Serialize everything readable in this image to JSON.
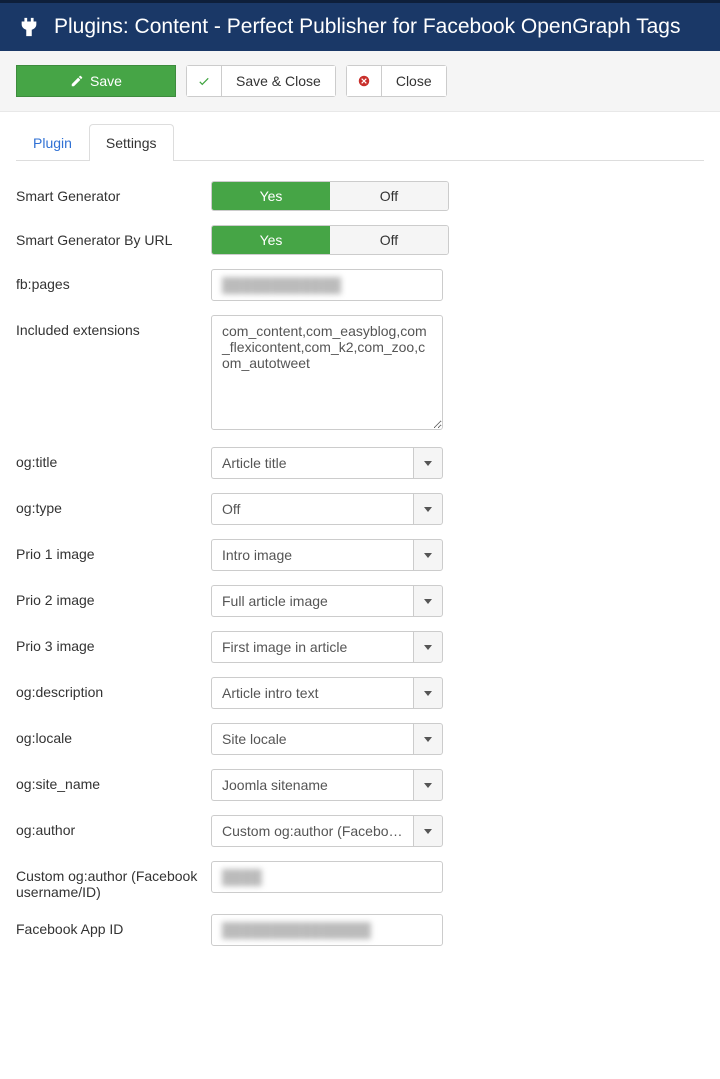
{
  "header": {
    "title": "Plugins: Content - Perfect Publisher for Facebook OpenGraph Tags"
  },
  "toolbar": {
    "save": "Save",
    "save_close": "Save & Close",
    "close": "Close"
  },
  "tabs": {
    "plugin": "Plugin",
    "settings": "Settings",
    "active": "settings"
  },
  "fields": {
    "smart_generator": {
      "label": "Smart Generator",
      "yes": "Yes",
      "no": "Off",
      "value": "Yes"
    },
    "smart_generator_url": {
      "label": "Smart Generator By URL",
      "yes": "Yes",
      "no": "Off",
      "value": "Yes"
    },
    "fb_pages": {
      "label": "fb:pages",
      "value": "████████████"
    },
    "included_ext": {
      "label": "Included extensions",
      "value": "com_content,com_easyblog,com_flexicontent,com_k2,com_zoo,com_autotweet"
    },
    "og_title": {
      "label": "og:title",
      "value": "Article title"
    },
    "og_type": {
      "label": "og:type",
      "value": "Off"
    },
    "prio1": {
      "label": "Prio 1 image",
      "value": "Intro image"
    },
    "prio2": {
      "label": "Prio 2 image",
      "value": "Full article image"
    },
    "prio3": {
      "label": "Prio 3 image",
      "value": "First image in article"
    },
    "og_description": {
      "label": "og:description",
      "value": "Article intro text"
    },
    "og_locale": {
      "label": "og:locale",
      "value": "Site locale"
    },
    "og_site_name": {
      "label": "og:site_name",
      "value": "Joomla sitename"
    },
    "og_author": {
      "label": "og:author",
      "value": "Custom og:author (Facebook…"
    },
    "custom_og_author": {
      "label": "Custom og:author (Facebook username/ID)",
      "value": "████"
    },
    "fb_app_id": {
      "label": "Facebook App ID",
      "value": "███████████████"
    }
  }
}
